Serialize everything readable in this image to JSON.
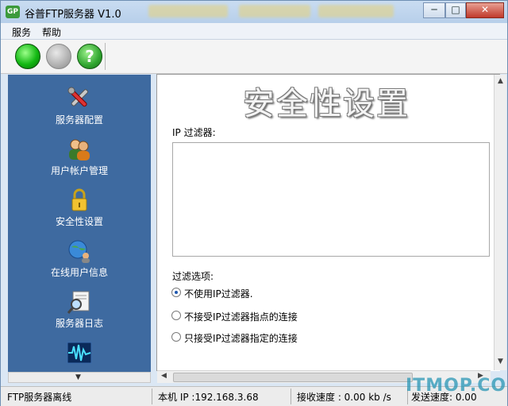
{
  "window": {
    "title": "谷普FTP服务器 V1.0",
    "app_icon_text": "GP",
    "controls": {
      "minimize": "─",
      "maximize": "□",
      "close": "✕"
    }
  },
  "menubar": {
    "items": [
      "服务",
      "帮助"
    ]
  },
  "toolbar": {
    "start_icon": "start-green-circle",
    "stop_icon": "stop-gray-circle",
    "help_icon": "help-question-circle",
    "help_glyph": "?"
  },
  "sidebar": {
    "items": [
      {
        "label": "服务器配置",
        "icon": "tools-icon"
      },
      {
        "label": "用户帐户管理",
        "icon": "users-icon"
      },
      {
        "label": "安全性设置",
        "icon": "lock-icon"
      },
      {
        "label": "在线用户信息",
        "icon": "globe-users-icon"
      },
      {
        "label": "服务器日志",
        "icon": "log-magnifier-icon"
      },
      {
        "label": "",
        "icon": "statistics-wave-icon"
      }
    ]
  },
  "content": {
    "heading": "安全性设置",
    "ip_filter_label": "IP 过滤器:",
    "filter_options_label": "过滤选项:",
    "options": [
      {
        "label": "不使用IP过滤器.",
        "selected": true
      },
      {
        "label": "不接受IP过滤器指点的连接",
        "selected": false
      },
      {
        "label": "只接受IP过滤器指定的连接",
        "selected": false
      }
    ]
  },
  "status": {
    "server_state": "FTP服务器离线",
    "local_ip": "本机 IP :192.168.3.68",
    "recv_speed": "接收速度 : 0.00   kb /s",
    "send_speed": "发送速度: 0.00"
  },
  "watermark": "ITMOP.COM",
  "colors": {
    "sidebar_bg": "#3e6aa0",
    "titlebar": "#c9dcf1",
    "close_button": "#c0392b"
  }
}
